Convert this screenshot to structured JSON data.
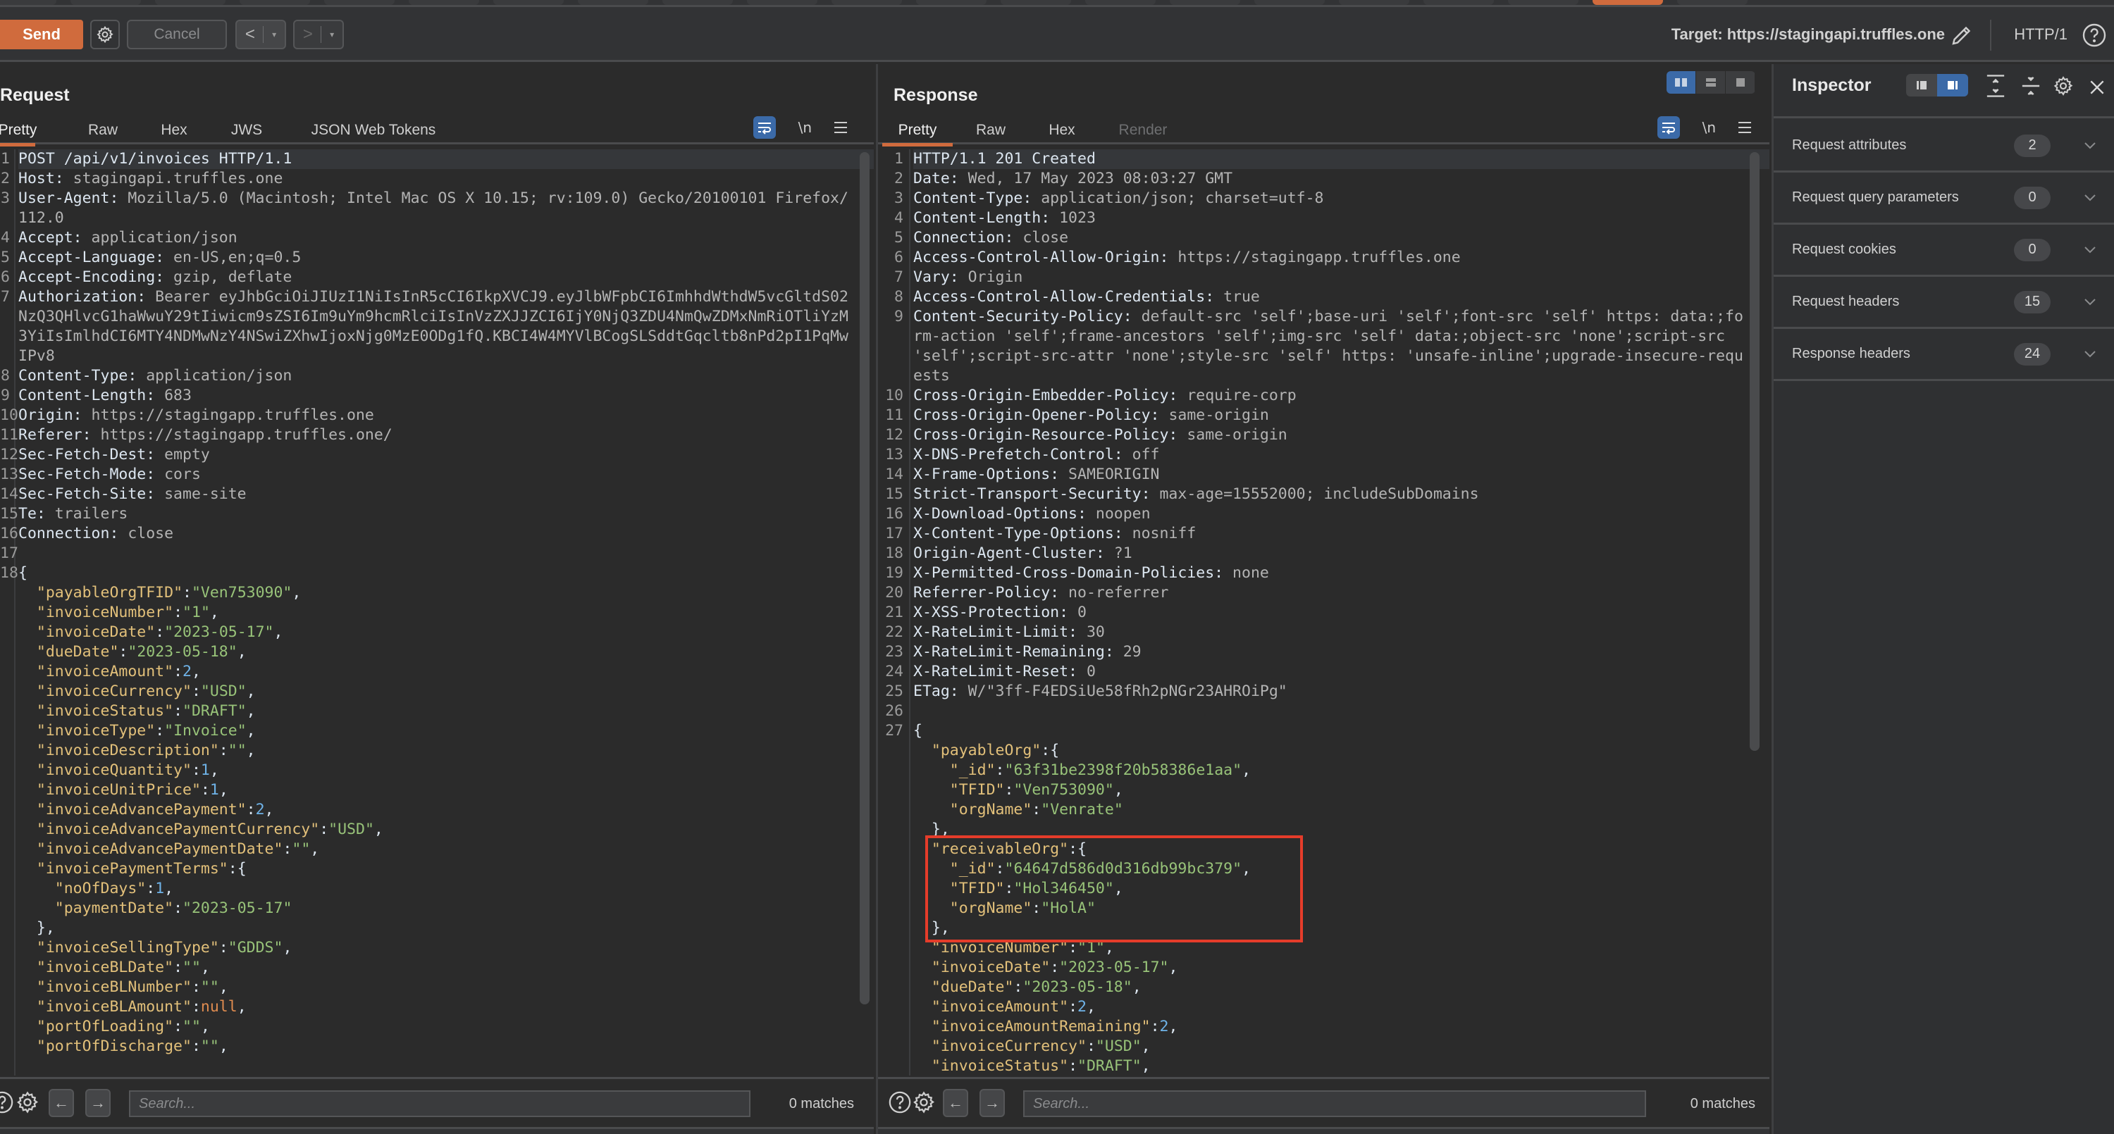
{
  "toolbar": {
    "send_label": "Send",
    "cancel_label": "Cancel",
    "back_label": "<",
    "forward_label": ">",
    "dropdown_glyph": "▾",
    "target_label": "Target: https://stagingapi.truffles.one",
    "http_version": "HTTP/1",
    "icons": [
      "gear-icon",
      "pencil-icon",
      "help-icon"
    ]
  },
  "request": {
    "title": "Request",
    "tabs": [
      {
        "label": "Pretty",
        "active": true
      },
      {
        "label": "Raw"
      },
      {
        "label": "Hex"
      },
      {
        "label": "JWS"
      },
      {
        "label": "JSON Web Tokens"
      }
    ],
    "newline_label": "\\n",
    "headers": [
      {
        "n": "1",
        "line": "POST /api/v1/invoices HTTP/1.1"
      },
      {
        "n": "2",
        "name": "Host:",
        "value": " stagingapi.truffles.one"
      },
      {
        "n": "3",
        "name": "User-Agent:",
        "value": " Mozilla/5.0 (Macintosh; Intel Mac OS X 10.15; rv:109.0) Gecko/20100101 Firefox/112.0"
      },
      {
        "n": "4",
        "name": "Accept:",
        "value": " application/json"
      },
      {
        "n": "5",
        "name": "Accept-Language:",
        "value": " en-US,en;q=0.5"
      },
      {
        "n": "6",
        "name": "Accept-Encoding:",
        "value": " gzip, deflate"
      },
      {
        "n": "7",
        "name": "Authorization:",
        "value": " Bearer eyJhbGciOiJIUzI1NiIsInR5cCI6IkpXVCJ9.eyJlbWFpbCI6ImhhdWthdW5vcGltdS02NzQ3QHlvcG1haWwuY29tIiwicm9sZSI6Im9uYm9hcmRlciIsInVzZXJJZCI6IjY0NjQ3ZDU4NmQwZDMxNmRiOTliYzM3YiIsImlhdCI6MTY4NDMwNzY4NSwiZXhwIjoxNjg0MzE0ODg1fQ.KBCI4W4MYVlBCogSLSddtGqcltb8nPd2pI1PqMwIPv8"
      },
      {
        "n": "8",
        "name": "Content-Type:",
        "value": " application/json"
      },
      {
        "n": "9",
        "name": "Content-Length:",
        "value": " 683"
      },
      {
        "n": "10",
        "name": "Origin:",
        "value": " https://stagingapp.truffles.one"
      },
      {
        "n": "11",
        "name": "Referer:",
        "value": " https://stagingapp.truffles.one/"
      },
      {
        "n": "12",
        "name": "Sec-Fetch-Dest:",
        "value": " empty"
      },
      {
        "n": "13",
        "name": "Sec-Fetch-Mode:",
        "value": " cors"
      },
      {
        "n": "14",
        "name": "Sec-Fetch-Site:",
        "value": " same-site"
      },
      {
        "n": "15",
        "name": "Te:",
        "value": " trailers"
      },
      {
        "n": "16",
        "name": "Connection:",
        "value": " close"
      },
      {
        "n": "17",
        "line": ""
      }
    ],
    "body_start_line": "18",
    "body": [
      {
        "indent": 0,
        "punct": "{"
      },
      {
        "indent": 1,
        "key": "payableOrgTFID",
        "str": "Ven753090",
        "comma": true
      },
      {
        "indent": 1,
        "key": "invoiceNumber",
        "str": "1",
        "comma": true
      },
      {
        "indent": 1,
        "key": "invoiceDate",
        "str": "2023-05-17",
        "comma": true
      },
      {
        "indent": 1,
        "key": "dueDate",
        "str": "2023-05-18",
        "comma": true
      },
      {
        "indent": 1,
        "key": "invoiceAmount",
        "num": "2",
        "comma": true
      },
      {
        "indent": 1,
        "key": "invoiceCurrency",
        "str": "USD",
        "comma": true
      },
      {
        "indent": 1,
        "key": "invoiceStatus",
        "str": "DRAFT",
        "comma": true
      },
      {
        "indent": 1,
        "key": "invoiceType",
        "str": "Invoice",
        "comma": true
      },
      {
        "indent": 1,
        "key": "invoiceDescription",
        "str": "",
        "comma": true
      },
      {
        "indent": 1,
        "key": "invoiceQuantity",
        "num": "1",
        "comma": true
      },
      {
        "indent": 1,
        "key": "invoiceUnitPrice",
        "num": "1",
        "comma": true
      },
      {
        "indent": 1,
        "key": "invoiceAdvancePayment",
        "num": "2",
        "comma": true
      },
      {
        "indent": 1,
        "key": "invoiceAdvancePaymentCurrency",
        "str": "USD",
        "comma": true
      },
      {
        "indent": 1,
        "key": "invoiceAdvancePaymentDate",
        "str": "",
        "comma": true
      },
      {
        "indent": 1,
        "key": "invoicePaymentTerms",
        "open": "{"
      },
      {
        "indent": 2,
        "key": "noOfDays",
        "num": "1",
        "comma": true
      },
      {
        "indent": 2,
        "key": "paymentDate",
        "str": "2023-05-17"
      },
      {
        "indent": 1,
        "punct": "},"
      },
      {
        "indent": 1,
        "key": "invoiceSellingType",
        "str": "GDDS",
        "comma": true
      },
      {
        "indent": 1,
        "key": "invoiceBLDate",
        "str": "",
        "comma": true
      },
      {
        "indent": 1,
        "key": "invoiceBLNumber",
        "str": "",
        "comma": true
      },
      {
        "indent": 1,
        "key": "invoiceBLAmount",
        "nul": "null",
        "comma": true
      },
      {
        "indent": 1,
        "key": "portOfLoading",
        "str": "",
        "comma": true
      },
      {
        "indent": 1,
        "key": "portOfDischarge",
        "str": "",
        "comma": true
      }
    ],
    "search_placeholder": "Search...",
    "search_value": "",
    "matches": "0 matches"
  },
  "response": {
    "title": "Response",
    "tabs": [
      {
        "label": "Pretty",
        "active": true
      },
      {
        "label": "Raw"
      },
      {
        "label": "Hex"
      },
      {
        "label": "Render",
        "disabled": true
      }
    ],
    "newline_label": "\\n",
    "headers": [
      {
        "n": "1",
        "line": "HTTP/1.1 201 Created"
      },
      {
        "n": "2",
        "name": "Date:",
        "value": " Wed, 17 May 2023 08:03:27 GMT"
      },
      {
        "n": "3",
        "name": "Content-Type:",
        "value": " application/json; charset=utf-8"
      },
      {
        "n": "4",
        "name": "Content-Length:",
        "value": " 1023"
      },
      {
        "n": "5",
        "name": "Connection:",
        "value": " close"
      },
      {
        "n": "6",
        "name": "Access-Control-Allow-Origin:",
        "value": " https://stagingapp.truffles.one"
      },
      {
        "n": "7",
        "name": "Vary:",
        "value": " Origin"
      },
      {
        "n": "8",
        "name": "Access-Control-Allow-Credentials:",
        "value": " true"
      },
      {
        "n": "9",
        "name": "Content-Security-Policy:",
        "value": " default-src 'self';base-uri 'self';font-src 'self' https: data:;form-action 'self';frame-ancestors 'self';img-src 'self' data:;object-src 'none';script-src 'self';script-src-attr 'none';style-src 'self' https: 'unsafe-inline';upgrade-insecure-requests"
      },
      {
        "n": "10",
        "name": "Cross-Origin-Embedder-Policy:",
        "value": " require-corp"
      },
      {
        "n": "11",
        "name": "Cross-Origin-Opener-Policy:",
        "value": " same-origin"
      },
      {
        "n": "12",
        "name": "Cross-Origin-Resource-Policy:",
        "value": " same-origin"
      },
      {
        "n": "13",
        "name": "X-DNS-Prefetch-Control:",
        "value": " off"
      },
      {
        "n": "14",
        "name": "X-Frame-Options:",
        "value": " SAMEORIGIN"
      },
      {
        "n": "15",
        "name": "Strict-Transport-Security:",
        "value": " max-age=15552000; includeSubDomains"
      },
      {
        "n": "16",
        "name": "X-Download-Options:",
        "value": " noopen"
      },
      {
        "n": "17",
        "name": "X-Content-Type-Options:",
        "value": " nosniff"
      },
      {
        "n": "18",
        "name": "Origin-Agent-Cluster:",
        "value": " ?1"
      },
      {
        "n": "19",
        "name": "X-Permitted-Cross-Domain-Policies:",
        "value": " none"
      },
      {
        "n": "20",
        "name": "Referrer-Policy:",
        "value": " no-referrer"
      },
      {
        "n": "21",
        "name": "X-XSS-Protection:",
        "value": " 0"
      },
      {
        "n": "22",
        "name": "X-RateLimit-Limit:",
        "value": " 30"
      },
      {
        "n": "23",
        "name": "X-RateLimit-Remaining:",
        "value": " 29"
      },
      {
        "n": "24",
        "name": "X-RateLimit-Reset:",
        "value": " 0"
      },
      {
        "n": "25",
        "name": "ETag:",
        "value": " W/\"3ff-F4EDSiUe58fRh2pNGr23AHROiPg\""
      },
      {
        "n": "26",
        "line": ""
      }
    ],
    "body_start_line": "27",
    "body": [
      {
        "indent": 0,
        "punct": "{"
      },
      {
        "indent": 1,
        "key": "payableOrg",
        "open": "{"
      },
      {
        "indent": 2,
        "key": "_id",
        "str": "63f31be2398f20b58386e1aa",
        "comma": true
      },
      {
        "indent": 2,
        "key": "TFID",
        "str": "Ven753090",
        "comma": true
      },
      {
        "indent": 2,
        "key": "orgName",
        "str": "Venrate"
      },
      {
        "indent": 1,
        "punct": "},"
      },
      {
        "indent": 1,
        "key": "receivableOrg",
        "open": "{",
        "boxed": true
      },
      {
        "indent": 2,
        "key": "_id",
        "str": "64647d586d0d316db99bc379",
        "comma": true
      },
      {
        "indent": 2,
        "key": "TFID",
        "str": "Hol346450",
        "comma": true
      },
      {
        "indent": 2,
        "key": "orgName",
        "str": "HolA"
      },
      {
        "indent": 1,
        "punct": "},"
      },
      {
        "indent": 1,
        "key": "invoiceNumber",
        "str": "1",
        "comma": true
      },
      {
        "indent": 1,
        "key": "invoiceDate",
        "str": "2023-05-17",
        "comma": true
      },
      {
        "indent": 1,
        "key": "dueDate",
        "str": "2023-05-18",
        "comma": true
      },
      {
        "indent": 1,
        "key": "invoiceAmount",
        "num": "2",
        "comma": true
      },
      {
        "indent": 1,
        "key": "invoiceAmountRemaining",
        "num": "2",
        "comma": true
      },
      {
        "indent": 1,
        "key": "invoiceCurrency",
        "str": "USD",
        "comma": true
      },
      {
        "indent": 1,
        "key": "invoiceStatus",
        "str": "DRAFT",
        "comma": true
      }
    ],
    "search_placeholder": "Search...",
    "search_value": "",
    "matches": "0 matches"
  },
  "inspector": {
    "title": "Inspector",
    "sections": [
      {
        "label": "Request attributes",
        "count": "2"
      },
      {
        "label": "Request query parameters",
        "count": "0"
      },
      {
        "label": "Request cookies",
        "count": "0"
      },
      {
        "label": "Request headers",
        "count": "15"
      },
      {
        "label": "Response headers",
        "count": "24"
      }
    ]
  },
  "colors": {
    "accent": "#d06b3d",
    "selected": "#3b6aa8",
    "highlight_box": "#e53c2a",
    "json_key": "#e2c07a",
    "json_string": "#98c379",
    "json_number": "#6fb3e8",
    "json_null": "#e08c50"
  }
}
